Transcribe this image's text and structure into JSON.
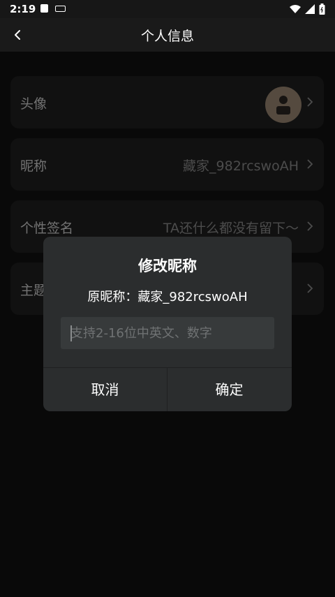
{
  "status_bar": {
    "time": "2:19"
  },
  "header": {
    "title": "个人信息"
  },
  "rows": [
    {
      "label": "头像"
    },
    {
      "label": "昵称",
      "value": "藏家_982rcswoAH"
    },
    {
      "label": "个性签名",
      "value": "TA还什么都没有留下～"
    },
    {
      "label": "主题"
    }
  ],
  "dialog": {
    "title": "修改昵称",
    "original_nickname": "原昵称：藏家_982rcswoAH",
    "input_placeholder": "支持2-16位中英文、数字",
    "input_value": "",
    "cancel_label": "取消",
    "confirm_label": "确定"
  },
  "colors": {
    "background": "#111111",
    "row_background": "#1f1f1f",
    "dialog_background": "#2b2d2e",
    "avatar": "#9c8873"
  },
  "icons": [
    "back-arrow-icon",
    "chevron-right-icon",
    "avatar-person-icon",
    "wifi-icon",
    "signal-icon",
    "battery-icon"
  ]
}
